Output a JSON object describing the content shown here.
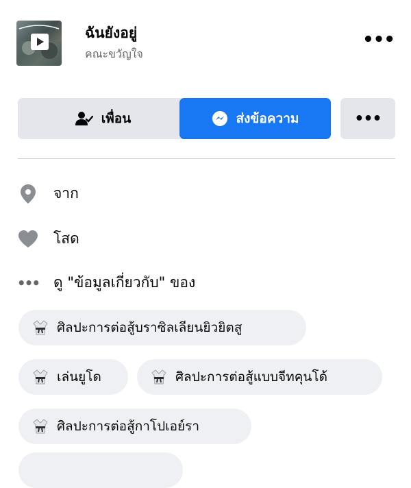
{
  "music": {
    "song_title": "ฉันยังอยู่",
    "artist": "คณะขวัญใจ",
    "more_label": "•••"
  },
  "actions": {
    "friend_label": "เพื่อน",
    "message_label": "ส่งข้อความ",
    "more_label": "•••"
  },
  "info": {
    "from": "จาก",
    "relationship": "โสด",
    "about": "ดู \"ข้อมูลเกี่ยวกับ\" ของ"
  },
  "interests": [
    {
      "label": "ศิลปะการต่อสู้บราซิลเลียนยิวยิตสู",
      "icon": "martial-arts-uniform-icon"
    },
    {
      "label": "เล่นยูโด",
      "icon": "martial-arts-uniform-icon"
    },
    {
      "label": "ศิลปะการต่อสู้แบบจีทคุนโด้",
      "icon": "martial-arts-uniform-icon"
    },
    {
      "label": "ศิลปะการต่อสู้กาโปเอย์รา",
      "icon": "martial-arts-uniform-icon"
    }
  ],
  "colors": {
    "primary": "#1877f2",
    "button_gray": "#e4e6eb",
    "chip_bg": "#eef0f3",
    "secondary_text": "#65676b",
    "icon_gray": "#8a8d91"
  }
}
